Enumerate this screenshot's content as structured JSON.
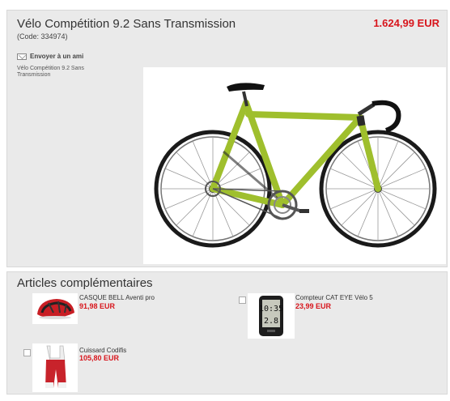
{
  "product": {
    "title": "Vélo Compétition 9.2 Sans Transmission",
    "code": "(Code: 334974)",
    "price": "1.624,99 EUR",
    "share_label": "Envoyer à un ami",
    "image_caption": "Vélo Compétition 9.2 Sans Transmission"
  },
  "complements": {
    "heading": "Articles complémentaires",
    "items": [
      {
        "name": "CASQUE BELL Aventi pro",
        "price": "91,98 EUR"
      },
      {
        "name": "Compteur CAT EYE Vélo 5",
        "price": "23,99 EUR",
        "screen_top": "10:35",
        "screen_bottom": "2.8"
      },
      {
        "name": "Cuissard Codifis",
        "price": "105,80 EUR"
      }
    ]
  },
  "colors": {
    "accent_price": "#d8151c",
    "panel": "#eaeaea",
    "frame": "#9fbf2d"
  }
}
